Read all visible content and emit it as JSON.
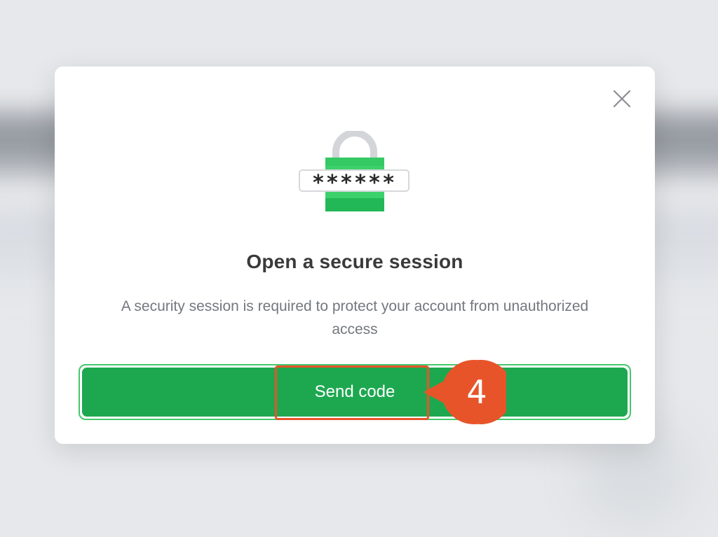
{
  "modal": {
    "title": "Open a secure session",
    "description": "A security session is required to protect your account from unauthorized access",
    "send_button_label": "Send code",
    "password_mask": "******",
    "close_icon": "close-icon",
    "lock_icon": "lock-password-icon"
  },
  "annotation": {
    "step_number": "4",
    "color": "#e8542a"
  },
  "colors": {
    "primary_button": "#1da850",
    "button_outline": "#44c96a",
    "lock_green": "#3dd16b",
    "title": "#3a3a3a",
    "description": "#74787e"
  }
}
